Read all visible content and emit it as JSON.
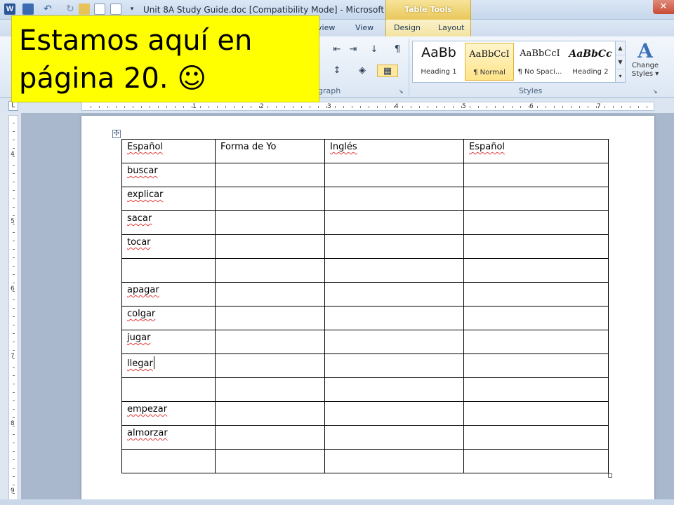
{
  "window": {
    "title": "Unit 8A Study Guide.doc [Compatibility Mode]  -  Microsoft ...",
    "context_tab_header": "Table Tools",
    "app_icon_letter": "W",
    "close_glyph": "✕"
  },
  "ribbon_tabs": {
    "review": "view",
    "view": "View",
    "design": "Design",
    "layout": "Layout"
  },
  "ribbon": {
    "paragraph_group": "graph",
    "styles_group": "Styles",
    "styles": [
      {
        "sample": "AaBb",
        "name": "Heading 1"
      },
      {
        "sample": "AaBbCcI",
        "name": "¶ Normal"
      },
      {
        "sample": "AaBbCcI",
        "name": "¶ No Spaci..."
      },
      {
        "sample": "AaBbCc",
        "name": "Heading 2"
      }
    ],
    "change_styles": "Change Styles ▾",
    "change_styles_glyph": "A"
  },
  "ruler": {
    "corner": "L",
    "numbers": [
      "1",
      "2",
      "3",
      "4",
      "5",
      "6",
      "7"
    ],
    "v_numbers": [
      "4",
      "5",
      "6",
      "7",
      "8",
      "9"
    ]
  },
  "table": {
    "headers": [
      "Español",
      "Forma de Yo",
      "Inglés",
      "Español"
    ],
    "rows": [
      "buscar",
      "explicar",
      "sacar",
      "tocar",
      "",
      "apagar",
      "colgar",
      "jugar",
      "llegar",
      "",
      "empezar",
      "almorzar",
      ""
    ]
  },
  "callout": {
    "text": "Estamos  aquí en\npágina 20.  ☺"
  }
}
